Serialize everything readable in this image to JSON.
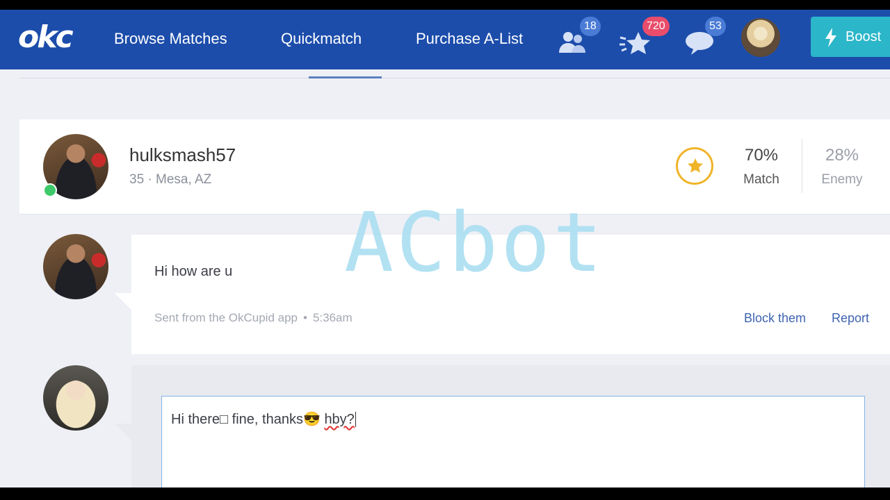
{
  "nav": {
    "logo": "okc",
    "links": [
      "Browse Matches",
      "Quickmatch",
      "Purchase A-List"
    ],
    "icons": [
      {
        "name": "people-icon",
        "badge": "18",
        "badge_color": "#4a7cd6"
      },
      {
        "name": "star-burst-icon",
        "badge": "720",
        "badge_color": "#e94d6b"
      },
      {
        "name": "chat-icon",
        "badge": "53",
        "badge_color": "#4a7cd6"
      }
    ],
    "boost_label": "Boost"
  },
  "profile": {
    "username": "hulksmash57",
    "info": "35 · Mesa, AZ",
    "online": true,
    "match_pct": "70%",
    "match_label": "Match",
    "enemy_pct": "28%",
    "enemy_label": "Enemy"
  },
  "message": {
    "text": "Hi how are u",
    "source": "Sent from the OkCupid app",
    "separator": "•",
    "time": "5:36am",
    "actions": {
      "block": "Block them",
      "report": "Report"
    }
  },
  "reply": {
    "before": "Hi there",
    "missing_glyph": "□",
    "middle": " fine, thanks",
    "emoji": "😎",
    "misspelled": "hby?"
  },
  "watermark": "ACbot",
  "colors": {
    "nav_bg": "#1c4dab",
    "boost": "#2bb6c9",
    "link": "#3e63b0",
    "star": "#f0b429",
    "online": "#3ec96a"
  }
}
